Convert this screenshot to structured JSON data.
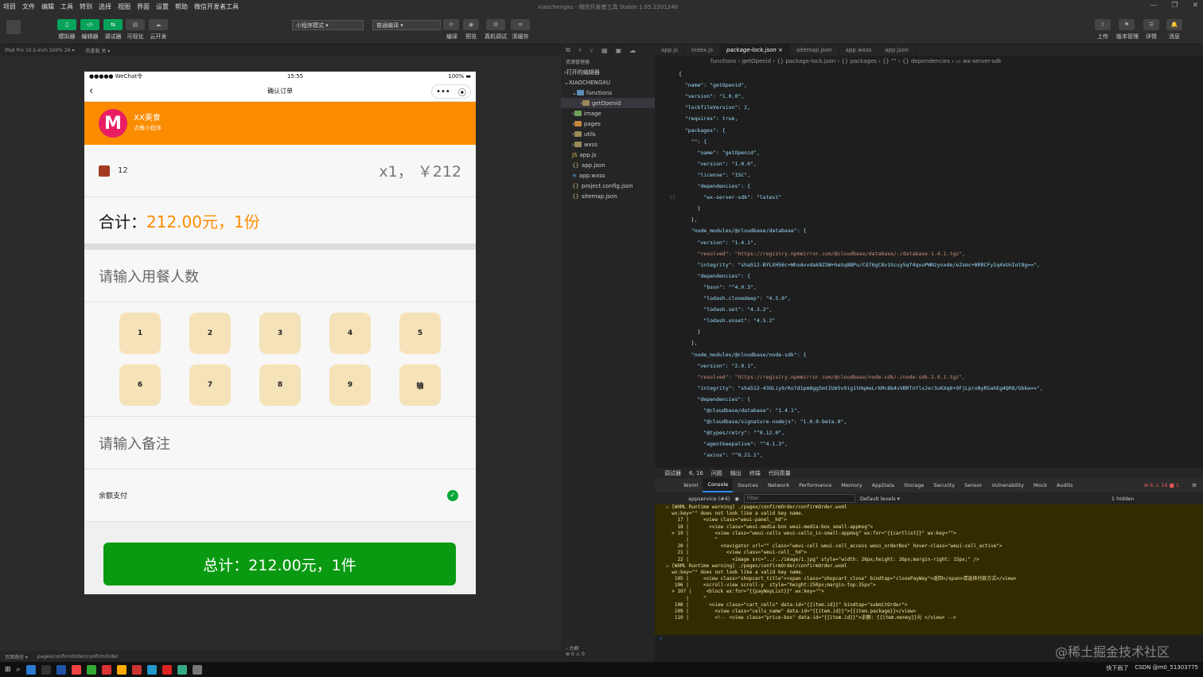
{
  "menu": [
    "项目",
    "文件",
    "编辑",
    "工具",
    "转到",
    "选择",
    "视图",
    "界面",
    "设置",
    "帮助",
    "微信开发者工具"
  ],
  "window_title": "xiaochengxu  ·  微信开发者工具 Stable 1.05.2201240",
  "toolbar": {
    "buttons": [
      "模拟器",
      "编辑器",
      "调试器",
      "可视化",
      "云开发"
    ],
    "mode_select": "小程序模式",
    "compile_select": "普通编译",
    "actions": [
      "编译",
      "预览",
      "真机调试",
      "清缓存"
    ],
    "right_actions": [
      "上传",
      "版本管理",
      "详情",
      "消息"
    ]
  },
  "device_bar": {
    "device": "iPad Pro 10.5-inch 100% 26 ▾",
    "hotreload": "热重载 关 ▾"
  },
  "phone": {
    "status_left": "●●●●● WeChat令",
    "status_time": "15:55",
    "status_right": "100%",
    "nav_title": "确认订单",
    "shop_logo": "M",
    "shop_name": "XX美食",
    "shop_sub": "点餐小程序",
    "cart_name": "12",
    "cart_price": "x1， ￥212",
    "total_label": "合计：",
    "total_amount": "212.00元，1份",
    "diners_placeholder": "请输入用餐人数",
    "keys": [
      "1",
      "2",
      "3",
      "4",
      "5",
      "6",
      "7",
      "8",
      "9",
      "输"
    ],
    "remark_placeholder": "请输入备注",
    "pay_method": "余额支付",
    "submit_label": "总计：212.00元，1件"
  },
  "bottom_status": {
    "path_label": "页面路径 ▾",
    "path": "pages/confirmOrder/confirmOrder"
  },
  "explorer": {
    "title": "资源管理器",
    "open_editors": "打开的编辑器",
    "project": "XIAOCHENGXU",
    "tree": [
      {
        "name": "functions",
        "type": "folder",
        "depth": 1
      },
      {
        "name": "getOpenid",
        "type": "folder",
        "depth": 2,
        "active": true
      },
      {
        "name": "image",
        "type": "folder",
        "depth": 1
      },
      {
        "name": "pages",
        "type": "folder",
        "depth": 1
      },
      {
        "name": "utils",
        "type": "folder",
        "depth": 1
      },
      {
        "name": "wxss",
        "type": "folder",
        "depth": 1
      },
      {
        "name": "app.js",
        "type": "js",
        "depth": 1
      },
      {
        "name": "app.json",
        "type": "json",
        "depth": 1
      },
      {
        "name": "app.wxss",
        "type": "wxss",
        "depth": 1
      },
      {
        "name": "project.config.json",
        "type": "json",
        "depth": 1
      },
      {
        "name": "sitemap.json",
        "type": "json",
        "depth": 1
      }
    ],
    "outline": "› 大纲",
    "problems": "⊗ 0 ⚠ 0"
  },
  "tabs": [
    "app.js",
    "index.js",
    "package-lock.json ×",
    "sitemap.json",
    "app.wxss",
    "app.json"
  ],
  "breadcrumb": "functions › getOpenid › {} package-lock.json › {} packages › {} \"\" › {} dependencies › ▭ wx-server-sdk",
  "code": [
    "{",
    "  \"name\": \"getOpenid\",",
    "  \"version\": \"1.0.0\",",
    "  \"lockfileVersion\": 2,",
    "  \"requires\": true,",
    "  \"packages\": {",
    "    \"\": {",
    "      \"name\": \"getOpenid\",",
    "      \"version\": \"1.0.0\",",
    "      \"license\": \"ISC\",",
    "      \"dependencies\": {",
    "        \"wx-server-sdk\": \"latest\"",
    "      }",
    "    },",
    "    \"node_modules/@cloudbase/database\": {",
    "      \"version\": \"1.4.1\",",
    "      \"resolved\": \"https://registry.npmmirror.com/@cloudbase/database/-/database-1.4.1.tgz\",",
    "      \"integrity\": \"sha512-BYLXH56c+WhxAvvdak8Z3W+heSq8BPu/CQ76gC8v1Scuy5qf4qxuPWNzyoxde/eZsmc+BRRCFyIq4xUnIot8g==\",",
    "      \"dependencies\": {",
    "        \"bson\": \"^4.0.3\",",
    "        \"lodash.clonedeep\": \"4.5.0\",",
    "        \"lodash.set\": \"4.3.2\",",
    "        \"lodash.unset\": \"4.5.2\"",
    "      }",
    "    },",
    "    \"node_modules/@cloudbase/node-sdk\": {",
    "      \"version\": \"2.9.1\",",
    "      \"resolved\": \"https://registry.npmmirror.com/@cloudbase/node-sdk/-/node-sdk-2.9.1.tgz\",",
    "      \"integrity\": \"sha512-43OLiy9/Ko7d1pm8gg5mtIUm5v9ig1tHqAeLrkMc8b4vVBRTnYlxJer3uKXq6+9FjLprxNyRSahEg4QR8/Gbkw==\",",
    "      \"dependencies\": {",
    "        \"@cloudbase/database\": \"1.4.1\",",
    "        \"@cloudbase/signature-nodejs\": \"1.0.0-beta.0\",",
    "        \"@types/retry\": \"^0.12.0\",",
    "        \"agentkeepalive\": \"^4.1.3\",",
    "        \"axios\": \"^0.21.1\","
  ],
  "console_bar": [
    "调试器",
    "6, 16",
    "问题",
    "输出",
    "终端",
    "代码质量"
  ],
  "devtools_tabs": [
    "Wxml",
    "Console",
    "Sources",
    "Network",
    "Performance",
    "Memory",
    "AppData",
    "Storage",
    "Security",
    "Sensor",
    "Vulnerability",
    "Mock",
    "Audits"
  ],
  "devtools_counts": "⊗ 6 ⚠ 16 ■ 1",
  "filter": {
    "context": "appservice (#4)",
    "placeholder": "Filter",
    "levels": "Default levels ▾",
    "hidden": "1 hidden"
  },
  "console_lines": [
    "⚠ [WXML Runtime warning] ./pages/confirmOrder/confirmOrder.wxml",
    "  wx:key=\"\" does not look like a valid key name.",
    "    17 |     <view class=\"weui-panel__hd\">",
    "    18 |       <view class=\"weui-media-box weui-media-box_small-appmsg\">",
    "  > 19 |         <view class=\"weui-cells weui-cells_in-small-appmsg\" wx:for=\"{{cartlist}}\" wx:key=\"\">",
    "       |         ^",
    "    20 |           <navigator url=\"\" class=\"weui-cell weui-cell_access weui_orderBox\" hover-class=\"weui-cell_active\">",
    "    21 |             <view class=\"weui-cell__hd\">",
    "    22 |               <image src=\"../../image/1.jpg\" style=\"width: 26px;height: 26px;margin-right: 15px;\" />",
    "⚠ [WXML Runtime warning] ./pages/confirmOrder/confirmOrder.wxml",
    "  wx:key=\"\" does not look like a valid key name.",
    "   105 |     <view class=\"shopcart_title\"><span class=\"shopcart_close\" bindtap=\"closePayWay\">返回</span>请选择付款方式</view>",
    "   106 |     <scroll-view scroll-y  style=\"height:250px;margin-top:35px\">",
    "  > 107 |     <block wx:for=\"{{payWayList}}\" wx:key=\"\">",
    "       |     ^",
    "   108 |       <view class=\"cart_cells\" data-id=\"{{item.id}}\" bindtap=\"submitOrder\">",
    "   109 |         <view class=\"cells_name\" data-id=\"{{item.id}}\">{{item.package}}</view>",
    "   110 |         <!-- <view class=\"price-box\" data-id=\"{{item.id}}\">余额: {{item.money}}元 </view> -->"
  ],
  "taskbar_right": [
    "快下雨了",
    "CSDN @m0_51303775"
  ],
  "watermark": "@稀土掘金技术社区"
}
